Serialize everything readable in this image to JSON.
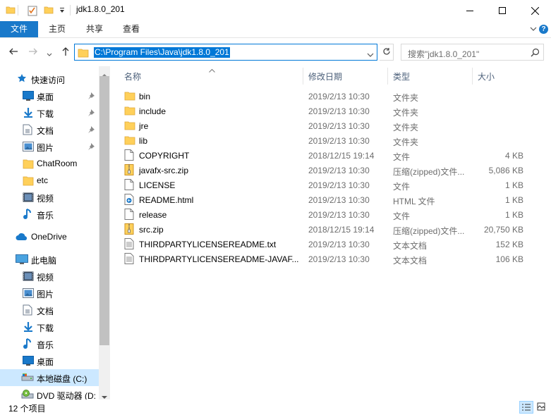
{
  "window": {
    "title": "jdk1.8.0_201"
  },
  "ribbon": {
    "tabs": [
      "文件",
      "主页",
      "共享",
      "查看"
    ]
  },
  "address": {
    "path": "C:\\Program Files\\Java\\jdk1.8.0_201",
    "search_placeholder": "搜索\"jdk1.8.0_201\""
  },
  "nav": {
    "items": [
      {
        "label": "快速访问",
        "icon": "star-icon"
      },
      {
        "label": "桌面",
        "icon": "desktop-icon",
        "pinned": true
      },
      {
        "label": "下载",
        "icon": "download-icon",
        "pinned": true
      },
      {
        "label": "文档",
        "icon": "document-icon",
        "pinned": true
      },
      {
        "label": "图片",
        "icon": "picture-icon",
        "pinned": true
      },
      {
        "label": "ChatRoom",
        "icon": "folder-icon"
      },
      {
        "label": "etc",
        "icon": "folder-icon"
      },
      {
        "label": "视频",
        "icon": "video-icon"
      },
      {
        "label": "音乐",
        "icon": "music-icon"
      },
      {
        "label": "OneDrive",
        "icon": "cloud-icon"
      },
      {
        "label": "此电脑",
        "icon": "computer-icon"
      },
      {
        "label": "视频",
        "icon": "video-icon"
      },
      {
        "label": "图片",
        "icon": "picture-icon"
      },
      {
        "label": "文档",
        "icon": "document-icon"
      },
      {
        "label": "下载",
        "icon": "download-icon"
      },
      {
        "label": "音乐",
        "icon": "music-icon"
      },
      {
        "label": "桌面",
        "icon": "desktop-icon"
      },
      {
        "label": "本地磁盘 (C:)",
        "icon": "drive-icon",
        "selected": true
      },
      {
        "label": "DVD 驱动器 (D:",
        "icon": "dvd-icon"
      }
    ]
  },
  "columns": {
    "name": "名称",
    "date": "修改日期",
    "type": "类型",
    "size": "大小"
  },
  "files": [
    {
      "name": "bin",
      "date": "2019/2/13 10:30",
      "type": "文件夹",
      "size": "",
      "icon": "folder-icon"
    },
    {
      "name": "include",
      "date": "2019/2/13 10:30",
      "type": "文件夹",
      "size": "",
      "icon": "folder-icon"
    },
    {
      "name": "jre",
      "date": "2019/2/13 10:30",
      "type": "文件夹",
      "size": "",
      "icon": "folder-icon"
    },
    {
      "name": "lib",
      "date": "2019/2/13 10:30",
      "type": "文件夹",
      "size": "",
      "icon": "folder-icon"
    },
    {
      "name": "COPYRIGHT",
      "date": "2018/12/15 19:14",
      "type": "文件",
      "size": "4 KB",
      "icon": "file-icon"
    },
    {
      "name": "javafx-src.zip",
      "date": "2019/2/13 10:30",
      "type": "压缩(zipped)文件...",
      "size": "5,086 KB",
      "icon": "zip-icon"
    },
    {
      "name": "LICENSE",
      "date": "2019/2/13 10:30",
      "type": "文件",
      "size": "1 KB",
      "icon": "file-icon"
    },
    {
      "name": "README.html",
      "date": "2019/2/13 10:30",
      "type": "HTML 文件",
      "size": "1 KB",
      "icon": "html-icon"
    },
    {
      "name": "release",
      "date": "2019/2/13 10:30",
      "type": "文件",
      "size": "1 KB",
      "icon": "file-icon"
    },
    {
      "name": "src.zip",
      "date": "2018/12/15 19:14",
      "type": "压缩(zipped)文件...",
      "size": "20,750 KB",
      "icon": "zip-icon"
    },
    {
      "name": "THIRDPARTYLICENSEREADME.txt",
      "date": "2019/2/13 10:30",
      "type": "文本文档",
      "size": "152 KB",
      "icon": "text-icon"
    },
    {
      "name": "THIRDPARTYLICENSEREADME-JAVAF...",
      "date": "2019/2/13 10:30",
      "type": "文本文档",
      "size": "106 KB",
      "icon": "text-icon"
    }
  ],
  "status": {
    "count": "12 个项目"
  },
  "colors": {
    "accent": "#1979ca",
    "selection": "#cce8ff",
    "folder": "#ffd05a",
    "header_text": "#4c607a"
  }
}
